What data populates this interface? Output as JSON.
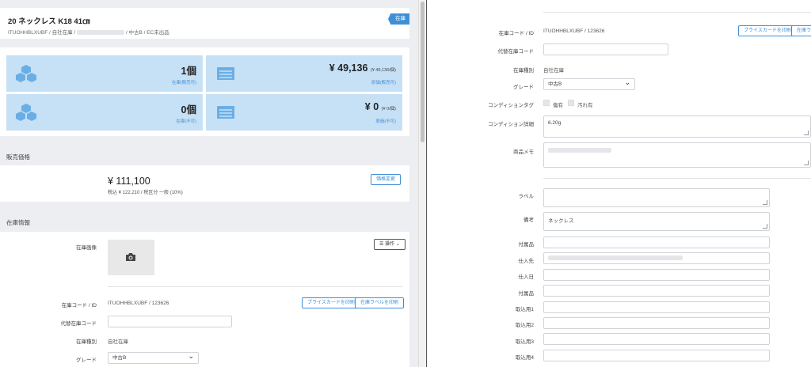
{
  "header": {
    "title": "20 ネックレス K18 41㎝",
    "subtitle_left": "ITUOHHBLXUBF / 自社在庫 /",
    "subtitle_right": "/ 中古B / EC未出品",
    "ribbon": "在庫"
  },
  "stats": [
    {
      "value": "1個",
      "extra": "",
      "label": "在庫(販売可)"
    },
    {
      "value": "¥ 49,136",
      "extra": "(¥ 49,136/個)",
      "label": "原価(販売可)"
    },
    {
      "value": "0個",
      "extra": "",
      "label": "在庫(不可)"
    },
    {
      "value": "¥ 0",
      "extra": "(¥ 0/個)",
      "label": "原価(不可)"
    }
  ],
  "price": {
    "section": "販売価格",
    "main": "¥ 111,100",
    "sub": "税込 ¥ 122,210 / 税区分 一般 (10%)",
    "change_button": "価格変更"
  },
  "stock": {
    "section": "在庫情報",
    "image_label": "在庫画像",
    "ops_button": "操作",
    "code_label": "在庫コード / ID",
    "code_value": "ITUOHHBLXUBF / 123626",
    "print_price_card": "プライスカードを印刷",
    "print_stock_label": "在庫ラベルを印刷",
    "alt_code_label": "代替在庫コード",
    "type_label": "在庫種別",
    "type_value": "自社在庫",
    "grade_label": "グレード",
    "grade_value": "中古B"
  },
  "right": {
    "code_label": "在庫コード / ID",
    "code_value": "ITUOHHBLXUBF / 123626",
    "print_price_card": "プライスカードを印刷",
    "print_stock_label": "在庫ラ",
    "alt_code_label": "代替在庫コード",
    "type_label": "在庫種別",
    "type_value": "自社在庫",
    "grade_label": "グレード",
    "grade_value": "中古B",
    "condition_tag_label": "コンディションタグ",
    "tag1": "傷有",
    "tag2": "汚れ有",
    "condition_detail_label": "コンディション詳細",
    "condition_detail_value": "6.20g",
    "memo_label": "商品メモ",
    "label_label": "ラベル",
    "note_label": "備考",
    "note_value": "ネックレス",
    "accessory_label": "付属品",
    "supplier_label": "仕入先",
    "purchase_date_label": "仕入日",
    "accessory2_label": "付属品",
    "intake1_label": "取込用1",
    "intake2_label": "取込用2",
    "intake3_label": "取込用3",
    "intake4_label": "取込用4"
  },
  "colors": {
    "accent": "#3f8fd6",
    "stat_bg": "#c6e0f6"
  }
}
